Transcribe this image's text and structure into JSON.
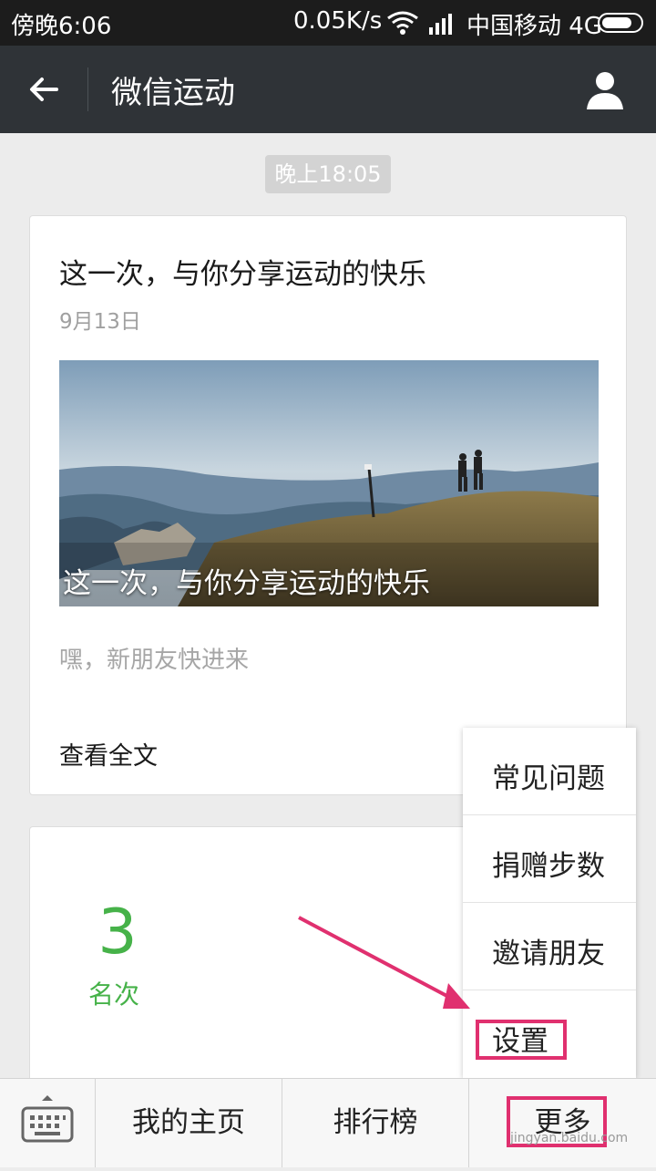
{
  "status_bar": {
    "time": "傍晚6:06",
    "speed": "0.05K/s",
    "carrier": "中国移动 4G",
    "battery_level": 0.8
  },
  "header": {
    "title": "微信运动",
    "back_icon": "back-arrow-icon",
    "profile_icon": "person-icon"
  },
  "timestamp": "晚上18:05",
  "article": {
    "title": "这一次，与你分享运动的快乐",
    "date": "9月13日",
    "image_caption": "这一次，与你分享运动的快乐",
    "description": "嘿，新朋友快进来",
    "read_more": "查看全文"
  },
  "rank": {
    "number": "3",
    "label": "名次"
  },
  "popup_menu": {
    "items": [
      {
        "label": "常见问题"
      },
      {
        "label": "捐赠步数"
      },
      {
        "label": "邀请朋友"
      },
      {
        "label": "设置"
      }
    ]
  },
  "bottom_bar": {
    "keyboard_icon": "keyboard-icon",
    "tabs": [
      {
        "label": "我的主页"
      },
      {
        "label": "排行榜"
      },
      {
        "label": "更多"
      }
    ]
  },
  "watermark": "jingyan.baidu.com",
  "colors": {
    "accent_green": "#46b249",
    "header_bg": "#2f3337",
    "annotation_pink": "#e0306f"
  }
}
